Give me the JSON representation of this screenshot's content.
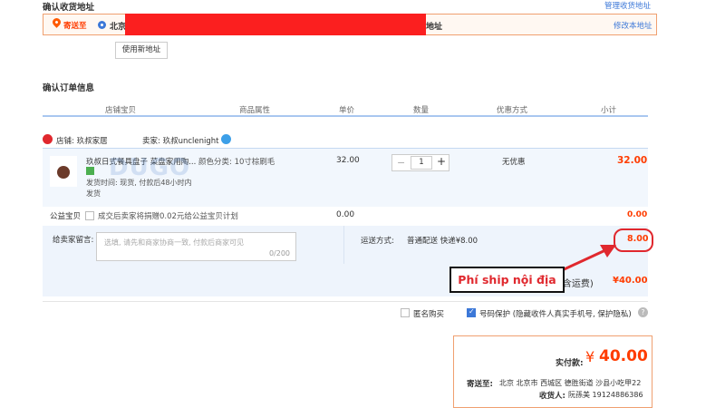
{
  "address_section": {
    "title": "确认收货地址",
    "manage_link": "管理收货地址",
    "ship_to_label": "寄送至",
    "address_start": "北京",
    "address_end": "地址",
    "modify_link": "修改本地址",
    "new_address_button": "使用新地址"
  },
  "order_section": {
    "title": "确认订单信息",
    "columns": [
      "店铺宝贝",
      "商品属性",
      "单价",
      "数量",
      "优惠方式",
      "小计"
    ]
  },
  "shop": {
    "label": "店铺: 玖叔家居",
    "seller": "卖家: 玖叔unclenight"
  },
  "item": {
    "name": "玖叔日式餐具盘子 菜盘家用陶...",
    "watermark": "DUGO",
    "attr": "颜色分类: 10寸棕刷毛",
    "delivery": "发货时间: 现货, 付款后48小时内发货",
    "price": "32.00",
    "quantity": "1",
    "minus": "−",
    "plus": "+",
    "discount": "无优惠",
    "subtotal": "32.00"
  },
  "charity": {
    "label": "公益宝贝",
    "text": "成交后卖家将捐赠0.02元给公益宝贝计划",
    "price": "0.00",
    "subtotal": "0.00"
  },
  "message": {
    "label": "给卖家留言:",
    "placeholder": "选填, 请先和商家协商一致, 付款后商家可见",
    "counter": "0/200"
  },
  "shipping": {
    "label": "运送方式:",
    "method": "普通配送 快递¥8.00",
    "fee": "8.00"
  },
  "total": {
    "label_partial": "计(含运费)",
    "value": "¥40.00"
  },
  "options": {
    "anonymous": "匿名购买",
    "anonymous_checked": false,
    "protect": "号码保护 (隐藏收件人真实手机号, 保护隐私)",
    "protect_checked": true
  },
  "payment": {
    "label": "实付款:",
    "currency": "¥",
    "amount": "40.00",
    "ship_to_label": "寄送至:",
    "ship_to": "北京 北京市 西城区 德胜街道 沙县小吃甲22",
    "recipient_label": "收货人:",
    "recipient": "阮孫美 19124886386"
  },
  "annotation": {
    "text": "Phí ship nội địa"
  },
  "colors": {
    "accent_orange": "#ff3c00",
    "annotation_red": "#e0282e",
    "link_blue": "#3c78d8"
  }
}
